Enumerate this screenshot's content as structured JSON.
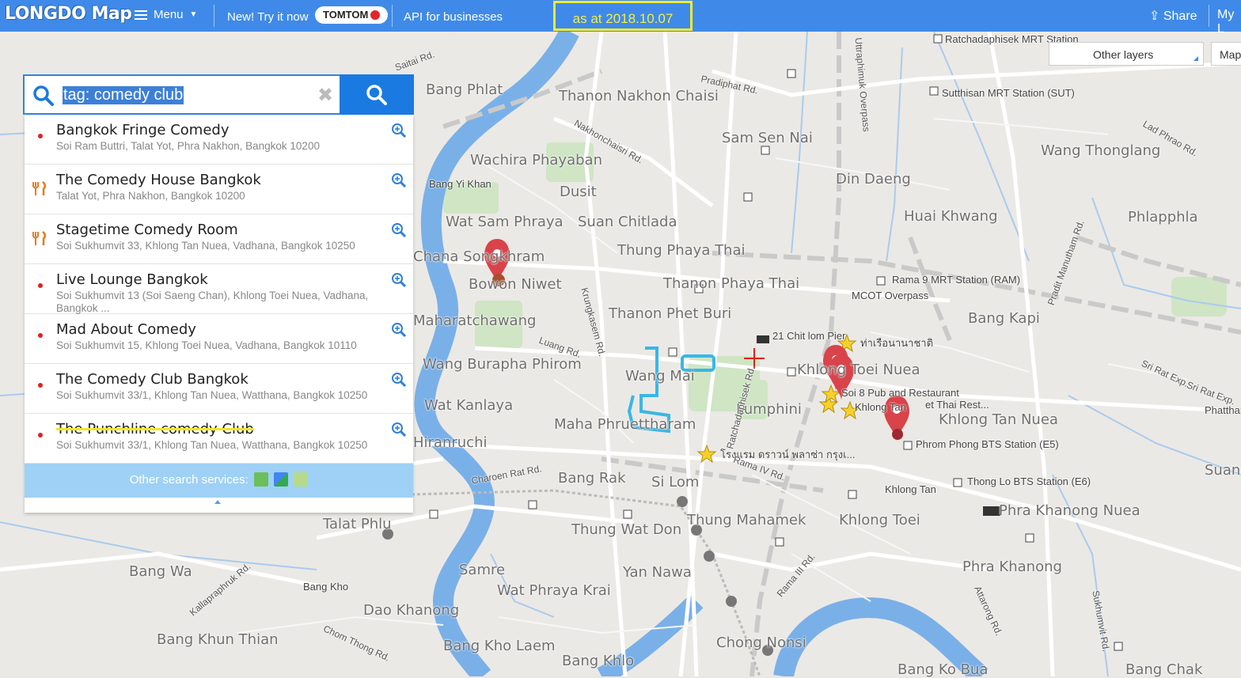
{
  "topbar": {
    "logo": "LONGDO Map",
    "menu_label": "Menu",
    "try_label": "New! Try it now",
    "tomtom_label": "TOMTOM",
    "api_label": "API for businesses",
    "as_at": "as at 2018.10.07",
    "share_label": "Share",
    "my_label": "My L"
  },
  "controls": {
    "layers_label": "Other layers",
    "map_label": "Map"
  },
  "search": {
    "query": "tag: comedy club",
    "other_services_label": "Other search services:"
  },
  "results": [
    {
      "name": "Bangkok Fringe Comedy",
      "address": "Soi Ram Buttri, Talat Yot, Phra Nakhon, Bangkok 10200",
      "icon": "red-dot"
    },
    {
      "name": "The Comedy House Bangkok",
      "address": "Talat Yot, Phra Nakhon, Bangkok 10200",
      "icon": "restaurant-icon"
    },
    {
      "name": "Stagetime Comedy Room",
      "address": "Soi Sukhumvit 33, Khlong Tan Nuea, Vadhana, Bangkok 10250",
      "icon": "restaurant-icon"
    },
    {
      "name": "Live Lounge Bangkok",
      "address": "Soi Sukhumvit 13 (Soi Saeng Chan), Khlong Toei Nuea, Vadhana, Bangkok ...",
      "icon": "red-dot"
    },
    {
      "name": "Mad About Comedy",
      "address": "Soi Sukhumvit 15, Khlong Toei Nuea, Vadhana, Bangkok 10110",
      "icon": "red-dot"
    },
    {
      "name": "The Comedy Club Bangkok",
      "address": "Soi Sukhumvit 33/1, Khlong Tan Nuea, Watthana, Bangkok 10250",
      "icon": "red-dot"
    },
    {
      "name": "The Punchline comedy Club",
      "address": "Soi Sukhumvit 33/1, Khlong Tan Nuea, Watthana, Bangkok 10250",
      "icon": "red-dot"
    }
  ],
  "map_labels": [
    "Bang Phlat",
    "Thanon Nakhon Chaisi",
    "Pradiphat Rd.",
    "Sam Sen Nai",
    "Wang Thonglang",
    "Lad Phrao Rd.",
    "Wachira Phayaban",
    "Nakhonchaisri Rd.",
    "Bang Yi Khan",
    "Dusit",
    "Din Daeng",
    "Huai Khwang",
    "Phlapphla",
    "Wat Sam Phraya",
    "Suan Chitlada",
    "Chana Songkhram",
    "Thung Phaya Thai",
    "Bowon Niwet",
    "Thanon Phaya Thai",
    "Rama 9 MRT Station (RAM)",
    "MCOT Overpass",
    "Thanon Phet Buri",
    "Bang Kapi",
    "Maharatchawang",
    "Luang Rd.",
    "Wang Burapha Phirom",
    "21 Chit lom Pier",
    "ท่าเรือนานาชาติ",
    "Wang Mai",
    "Khlong Toei Nuea",
    "Sri Rat Exp.",
    "Wat Kanlaya",
    "Lumphini",
    "Soi 8 Pub and Restaurant",
    "et Thai Rest...",
    "Khlong Tan Nuea",
    "Phatthana",
    "Maha Phruettharam",
    "Hiranruchi",
    "Phrom Phong BTS Station (E5)",
    "โรงแรม ดราวน์ พลาซ่า กรุงเ...",
    "Charoen Rat Rd.",
    "Bang Rak",
    "Si Lom",
    "Suan",
    "Khlong Tan",
    "Thong Lo BTS Station (E6)",
    "Talat Phlu",
    "Thung Wat Don",
    "Thung Mahamek",
    "Khlong Toei",
    "Phra Khanong Nuea",
    "Bang Wa",
    "Samre",
    "Yan Nawa",
    "Rama III Rd.",
    "Phra Khanong",
    "Kallapraphruk Rd.",
    "Bang Kho",
    "Wat Phraya Krai",
    "Dao Khanong",
    "Bang Khun Thian",
    "Chom Thong Rd.",
    "Bang Kho Laem",
    "Chong Nonsi",
    "Bang Khlo",
    "Bang Ko Bua",
    "Bang Chak",
    "Ratchadaphisek MRT Station",
    "Sutthisan MRT Station (SUT)",
    "Krungkasem Rd.",
    "Ratchadaphisek Rd.",
    "Rama IV Rd.",
    "Pradit Manutham Rd.",
    "Uttraphimuk Overpass",
    "Sri Rat Exp.",
    "Saitai Rd.",
    "Attarong Rd.",
    "Sukhumvit Rd.",
    "Khlong Tan"
  ],
  "colors": {
    "topbar": "#3f8ae8",
    "search_button": "#1a7ae2",
    "highlight": "#f5ea2c",
    "river": "#7ab0e8",
    "pin": "#d9434a"
  }
}
